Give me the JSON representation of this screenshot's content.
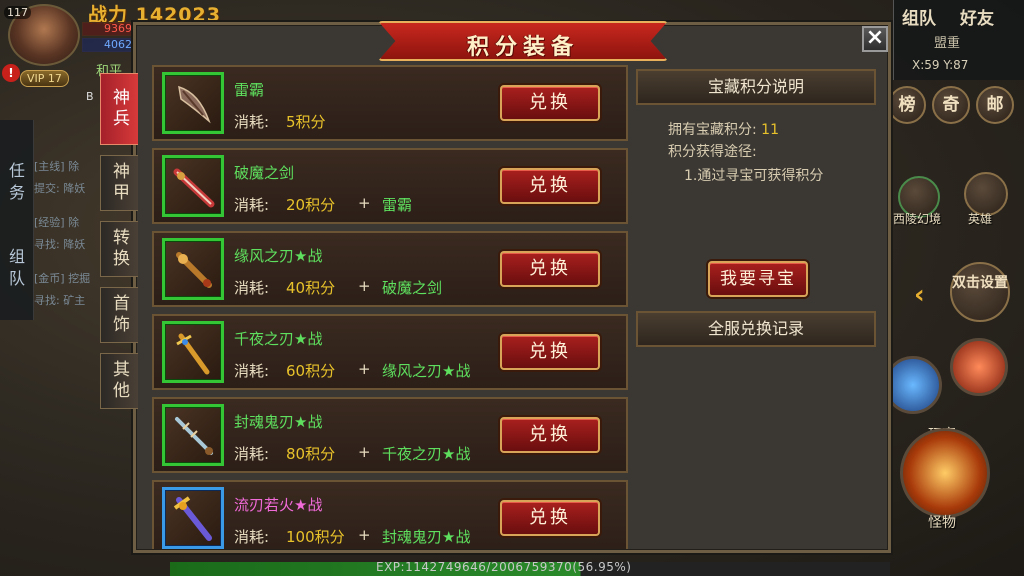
{
  "hud": {
    "level": "117",
    "power_label": "战力",
    "power_value": "142023",
    "hp": "9369",
    "mp": "4062",
    "vip": "VIP 17",
    "alert": "!",
    "mode": "和平",
    "bag_short": "B"
  },
  "quests": {
    "tabs": [
      "任务",
      "组队"
    ],
    "lines": [
      "[主线] 除",
      "提交: 降妖",
      "[经验] 除",
      "寻找: 降妖",
      "[金币] 挖掘",
      "寻找: 矿主"
    ]
  },
  "map": {
    "team_btn": "组队",
    "friend_btn": "好友",
    "name": "盟重",
    "coord": "X:59  Y:87"
  },
  "right_hud": {
    "rank": "榜",
    "odd": "奇",
    "mail": "邮",
    "west_label": "西陵幻境",
    "hero_label": "英雄",
    "double_click": "双击设置",
    "player": "玩家",
    "monster": "怪物"
  },
  "exp": "EXP:1142749646/2006759370(56.95%)",
  "dialog": {
    "title": "积分装备",
    "close": "×",
    "tabs": [
      {
        "label": "神兵",
        "active": true
      },
      {
        "label": "神甲",
        "active": false
      },
      {
        "label": "转换",
        "active": false
      },
      {
        "label": "首饰",
        "active": false
      },
      {
        "label": "其他",
        "active": false
      }
    ],
    "cost_label": "消耗:",
    "exchange_label": "兑换",
    "items": [
      {
        "name": "雷霸",
        "cost": "5积分",
        "requires": "",
        "frame": "green",
        "name_color": "green"
      },
      {
        "name": "破魔之剑",
        "cost": "20积分",
        "requires": "雷霸",
        "frame": "green",
        "name_color": "green"
      },
      {
        "name": "缘风之刃★战",
        "cost": "40积分",
        "requires": "破魔之剑",
        "frame": "green",
        "name_color": "green"
      },
      {
        "name": "千夜之刃★战",
        "cost": "60积分",
        "requires": "缘风之刃★战",
        "frame": "green",
        "name_color": "green"
      },
      {
        "name": "封魂鬼刃★战",
        "cost": "80积分",
        "requires": "千夜之刃★战",
        "frame": "green",
        "name_color": "green"
      },
      {
        "name": "流刃若火★战",
        "cost": "100积分",
        "requires": "封魂鬼刃★战",
        "frame": "blue",
        "name_color": "pink"
      }
    ],
    "plus": "+",
    "info": {
      "header": "宝藏积分说明",
      "points_label": "拥有宝藏积分:",
      "points_value": "11",
      "ways_label": "积分获得途径:",
      "way1": "1.通过寻宝可获得积分",
      "seek_btn": "我要寻宝",
      "record_btn": "全服兑换记录"
    }
  },
  "colors": {
    "accent_red": "#a8201e",
    "item_green": "#5ee05e",
    "item_pink": "#f06ad8",
    "points_gold": "#e8c22a"
  }
}
